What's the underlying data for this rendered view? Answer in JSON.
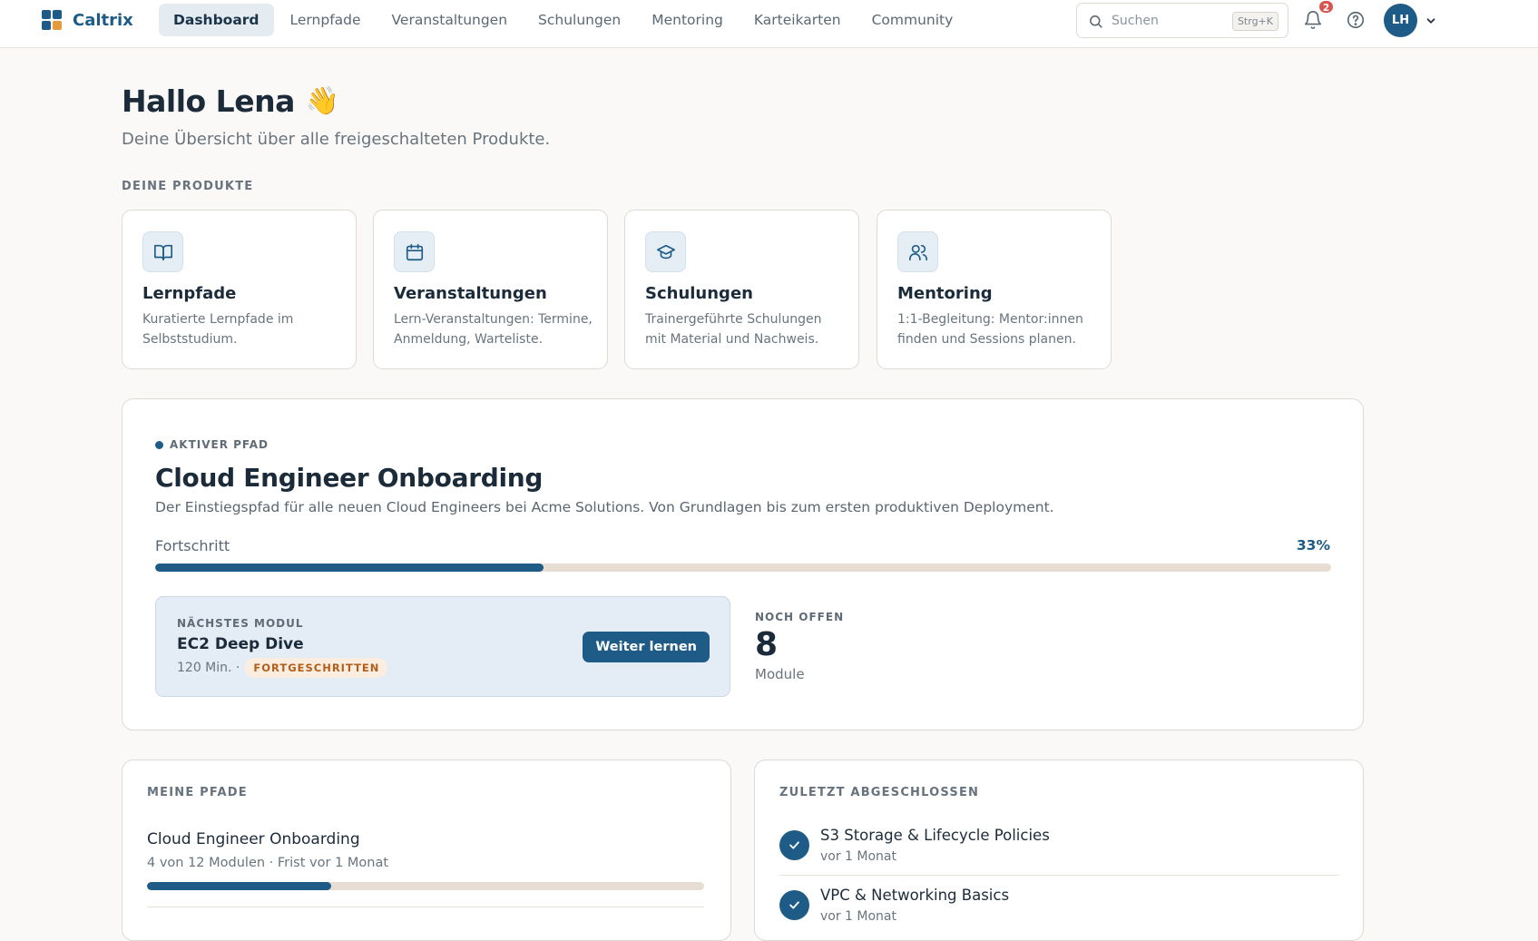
{
  "app": {
    "brand": "Caltrix",
    "brand_colors": [
      "#1e5c87",
      "#1e5c87",
      "#1e5c87",
      "#e49a3c"
    ]
  },
  "nav": {
    "tabs": [
      {
        "label": "Dashboard",
        "active": true
      },
      {
        "label": "Lernpfade"
      },
      {
        "label": "Veranstaltungen"
      },
      {
        "label": "Schulungen"
      },
      {
        "label": "Mentoring"
      },
      {
        "label": "Karteikarten"
      },
      {
        "label": "Community"
      }
    ],
    "search": {
      "placeholder": "Suchen",
      "shortcut": "Strg+K",
      "icon": "search-icon"
    },
    "notifications": {
      "count": "2",
      "icon": "bell-icon"
    },
    "help_icon": "help-circle-icon",
    "user": {
      "initials": "LH"
    }
  },
  "greeting": {
    "title": "Hallo Lena",
    "emoji": "👋",
    "subtitle": "Deine Übersicht über alle freigeschalteten Produkte."
  },
  "products": {
    "section_label": "DEINE PRODUKTE",
    "items": [
      {
        "title": "Lernpfade",
        "desc": "Kuratierte Lernpfade im Selbststudium.",
        "icon": "book-open-icon"
      },
      {
        "title": "Veranstaltungen",
        "desc": "Lern-Veranstaltungen: Termine, Anmeldung, Warteliste.",
        "icon": "calendar-icon"
      },
      {
        "title": "Schulungen",
        "desc": "Trainergeführte Schulungen mit Material und Nachweis.",
        "icon": "graduation-cap-icon"
      },
      {
        "title": "Mentoring",
        "desc": "1:1-Begleitung: Mentor:innen finden und Sessions planen.",
        "icon": "users-icon"
      }
    ]
  },
  "active_path": {
    "label": "AKTIVER PFAD",
    "title": "Cloud Engineer Onboarding",
    "desc": "Der Einstiegspfad für alle neuen Cloud Engineers bei Acme Solutions. Von Grundlagen bis zum ersten produktiven Deployment.",
    "progress_label": "Fortschritt",
    "progress_text": "33%",
    "progress": 0.33,
    "next_module": {
      "label": "NÄCHSTES MODUL",
      "title": "EC2 Deep Dive",
      "duration": "120 Min. ·",
      "level": "FORTGESCHRITTEN",
      "button": "Weiter lernen"
    },
    "open": {
      "label": "NOCH OFFEN",
      "count": "8",
      "unit": "Module"
    }
  },
  "my_paths": {
    "label": "MEINE PFADE",
    "items": [
      {
        "name": "Cloud Engineer Onboarding",
        "meta": "4 von 12 Modulen · Frist vor 1 Monat",
        "progress": 0.33
      }
    ]
  },
  "recently_completed": {
    "label": "ZULETZT ABGESCHLOSSEN",
    "items": [
      {
        "title": "S3 Storage & Lifecycle Policies",
        "time": "vor 1 Monat"
      },
      {
        "title": "VPC & Networking Basics",
        "time": "vor 1 Monat"
      }
    ]
  },
  "colors": {
    "accent": "#1e5c87",
    "background": "#faf9f7",
    "track": "#e8ddd3",
    "badge_bg": "#fbeee0",
    "badge_text": "#b25e1a",
    "notification": "#d9534f"
  }
}
